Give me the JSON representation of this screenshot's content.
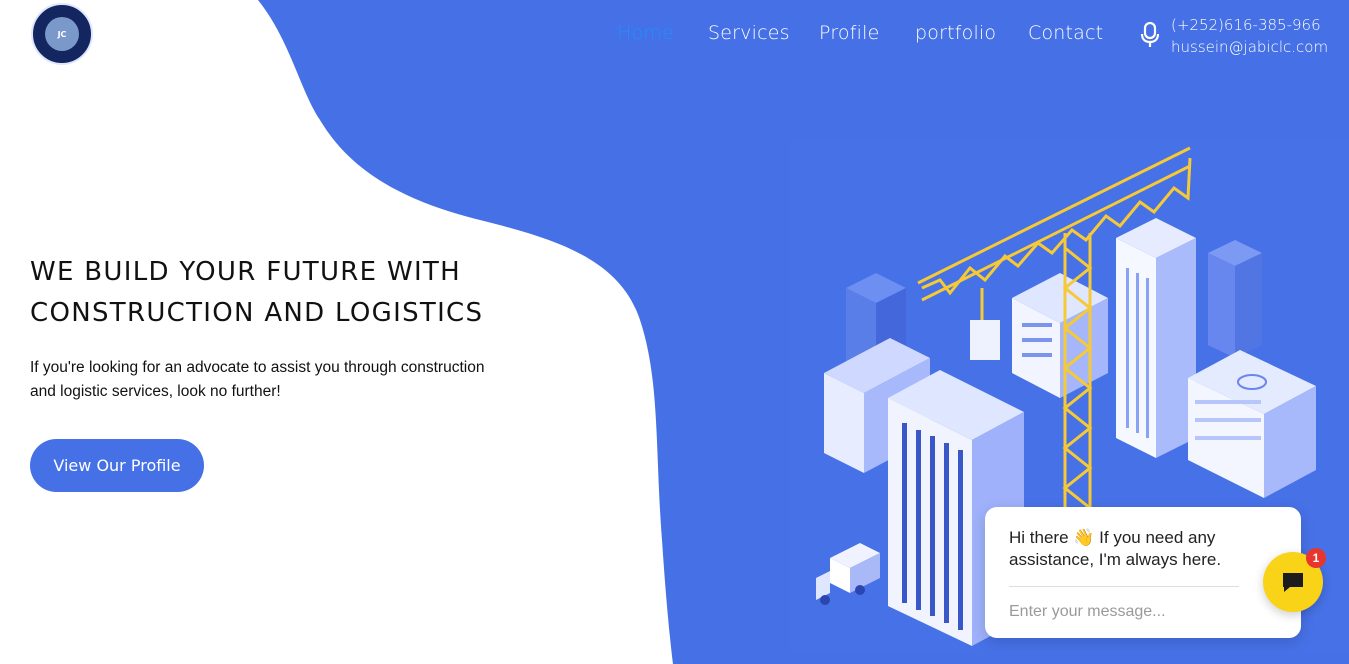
{
  "brand": {
    "logo_alt": "JABI CONSTRUCTION AND LOGISTICS",
    "logo_text": "JC"
  },
  "nav": [
    {
      "label": "Home",
      "active": true
    },
    {
      "label": "Services",
      "active": false
    },
    {
      "label": "Profile",
      "active": false
    },
    {
      "label": "portfolio",
      "active": false
    },
    {
      "label": "Contact",
      "active": false
    }
  ],
  "contact": {
    "phone": "(+252)616-385-966",
    "email": "hussein@jabiclc.com",
    "icon": "microphone-icon"
  },
  "hero": {
    "title_line1": "WE BUILD YOUR FUTURE WITH",
    "title_line2": "CONSTRUCTION AND LOGISTICS",
    "subtitle": "If you're looking for an advocate to assist you through construction and logistic services, look no further!",
    "cta_label": "View Our Profile"
  },
  "chat": {
    "greeting": "Hi there",
    "wave_emoji": "👋",
    "message": "If you need any assistance, I'm always here.",
    "input_placeholder": "Enter your message...",
    "badge_count": "1",
    "button_icon": "chat-bubble-icon"
  },
  "colors": {
    "primary_blue": "#4570e6",
    "nav_active": "#1e90ff",
    "crane_yellow": "#f6c935",
    "chat_button": "#f9d318",
    "badge_red": "#e8352e"
  }
}
